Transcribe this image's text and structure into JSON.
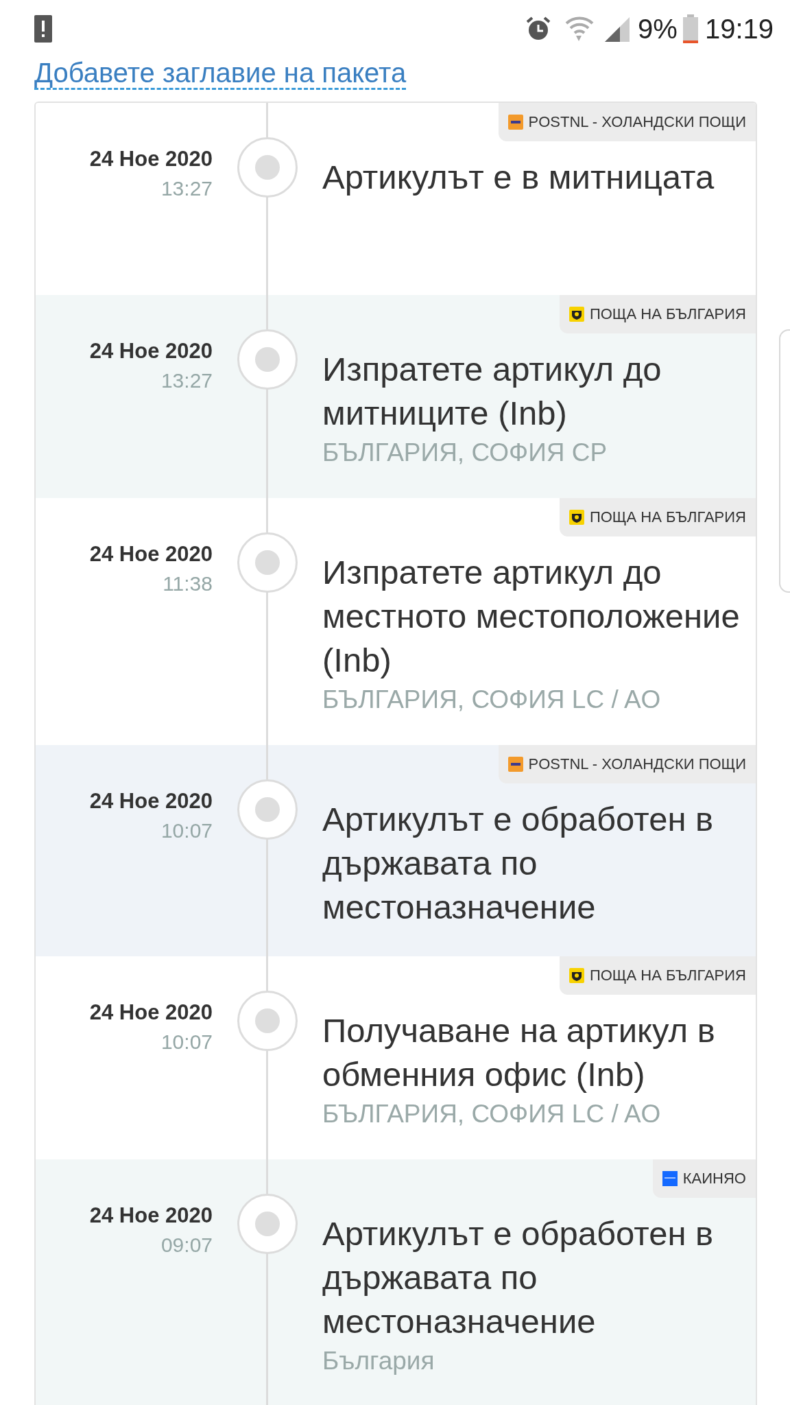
{
  "status_bar": {
    "battery_percent": "9%",
    "time": "19:19"
  },
  "title_link": "Добавете заглавие на пакета",
  "events": [
    {
      "date": "24 Ное 2020",
      "time": "13:27",
      "carrier": {
        "kind": "postnl",
        "name": "POSTNL - ХОЛАНДСКИ ПОЩИ"
      },
      "title": "Артикулът е в митницата"
    },
    {
      "date": "24 Ное 2020",
      "time": "13:27",
      "carrier": {
        "kind": "bgpost",
        "name": "ПОЩА НА БЪЛГАРИЯ"
      },
      "title": "Изпратете артикул до митниците (Inb)",
      "location": "БЪЛГАРИЯ, СОФИЯ CP"
    },
    {
      "date": "24 Ное 2020",
      "time": "11:38",
      "carrier": {
        "kind": "bgpost",
        "name": "ПОЩА НА БЪЛГАРИЯ"
      },
      "title": "Изпратете артикул до местното местоположение (Inb)",
      "location": "БЪЛГАРИЯ, СОФИЯ LC / AO"
    },
    {
      "date": "24 Ное 2020",
      "time": "10:07",
      "carrier": {
        "kind": "postnl",
        "name": "POSTNL - ХОЛАНДСКИ ПОЩИ"
      },
      "title": "Артикулът е обработен в държавата по местоназначение"
    },
    {
      "date": "24 Ное 2020",
      "time": "10:07",
      "carrier": {
        "kind": "bgpost",
        "name": "ПОЩА НА БЪЛГАРИЯ"
      },
      "title": "Получаване на артикул в обменния офис (Inb)",
      "location": "БЪЛГАРИЯ, СОФИЯ LC / AO"
    },
    {
      "date": "24 Ное 2020",
      "time": "09:07",
      "carrier": {
        "kind": "cainiao",
        "name": "КАИНЯО"
      },
      "title": "Артикулът е обработен в държавата по местоназначение",
      "location": "България"
    }
  ]
}
